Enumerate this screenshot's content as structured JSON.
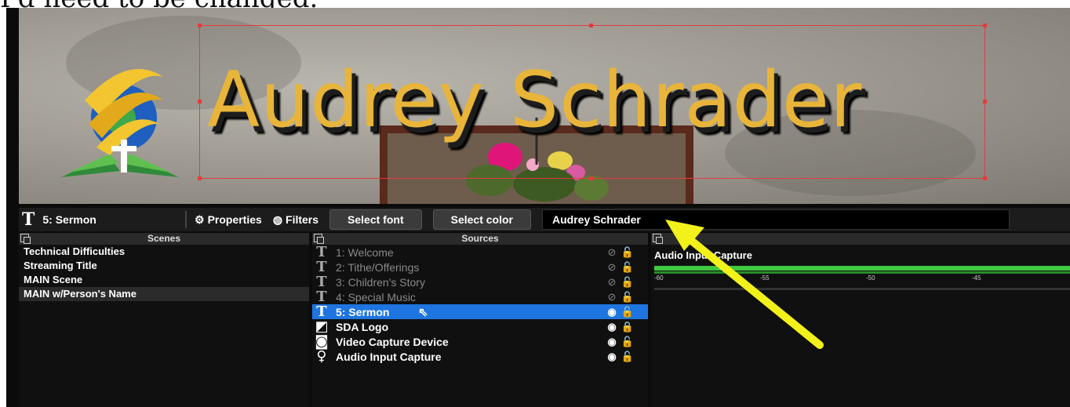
{
  "caption": "I'd need to be changed.",
  "preview": {
    "display_name": "Audrey Schrader"
  },
  "toolbar": {
    "source_name": "5: Sermon",
    "properties": "Properties",
    "filters": "Filters",
    "select_font": "Select font",
    "select_color": "Select color",
    "text_value": "Audrey Schrader"
  },
  "scenes": {
    "title": "Scenes",
    "items": [
      "Technical Difficulties",
      "Streaming Title",
      "MAIN Scene",
      "MAIN w/Person's Name"
    ]
  },
  "sources": {
    "title": "Sources",
    "items": [
      {
        "label": "1: Welcome",
        "icon": "text-icon",
        "visible": false
      },
      {
        "label": "2: Tithe/Offerings",
        "icon": "text-icon",
        "visible": false
      },
      {
        "label": "3: Children's Story",
        "icon": "text-icon",
        "visible": false
      },
      {
        "label": "4: Special Music",
        "icon": "text-icon",
        "visible": false
      },
      {
        "label": "5: Sermon",
        "icon": "text-icon",
        "visible": true
      },
      {
        "label": "SDA Logo",
        "icon": "image-icon",
        "visible": true
      },
      {
        "label": "Video Capture Device",
        "icon": "camera-icon",
        "visible": true
      },
      {
        "label": "Audio Input Capture",
        "icon": "microphone-icon",
        "visible": true
      }
    ]
  },
  "mixer": {
    "source": "Audio Input Capture",
    "ticks": [
      "-60",
      "-55",
      "-50",
      "-45"
    ]
  },
  "colors": {
    "selection_blue": "#1e75e0",
    "meter_green": "#3ec93e",
    "arrow_yellow": "#f2f21a",
    "title_gold": "#e8b53a",
    "bbox_red": "#e63b3b"
  }
}
